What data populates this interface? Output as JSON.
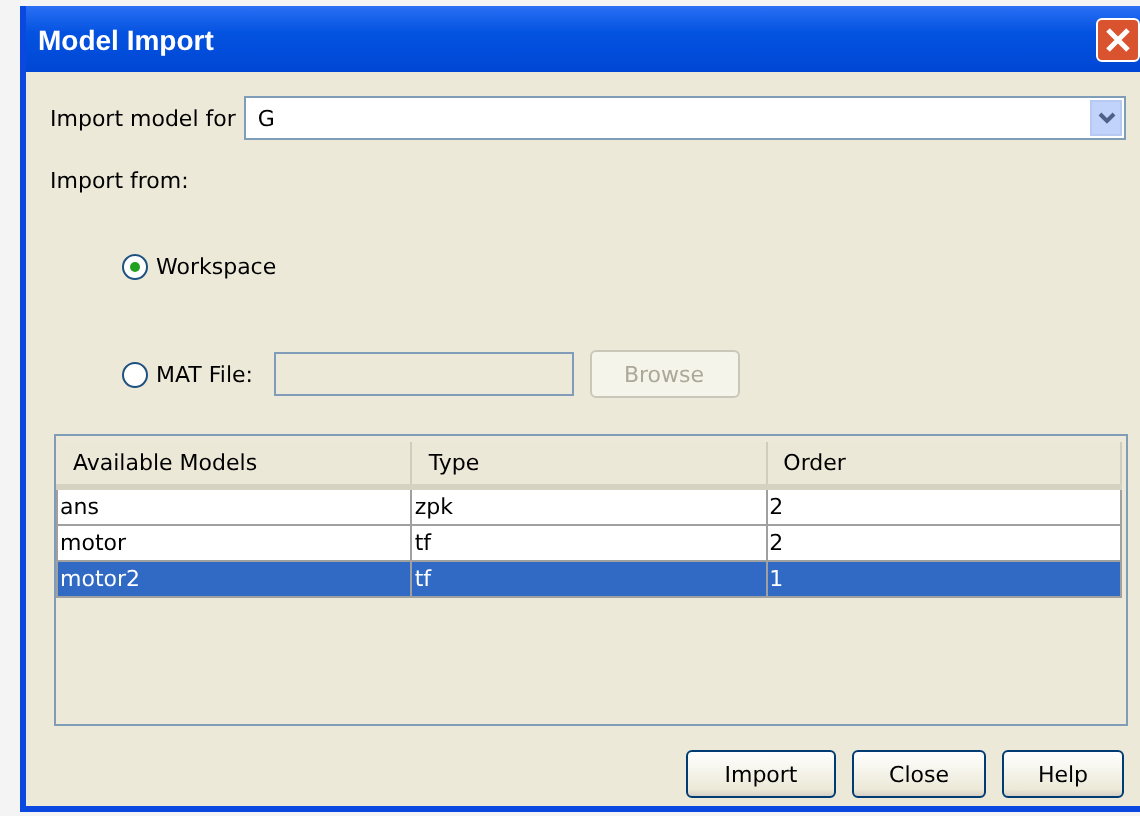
{
  "window": {
    "title": "Model Import"
  },
  "import_model_for": {
    "label": "Import model for",
    "value": "G"
  },
  "import_from": {
    "label": "Import from:",
    "options": [
      {
        "label": "Workspace",
        "selected": true,
        "kind": "plain"
      },
      {
        "label": "MAT File:",
        "selected": false,
        "kind": "file"
      }
    ]
  },
  "mat_file": {
    "disabled": true,
    "browse": {
      "label": "Browse",
      "disabled": true
    }
  },
  "table": {
    "columns": [
      "Available Models",
      "Type",
      "Order"
    ],
    "rows": [
      {
        "cells": [
          "ans",
          "zpk",
          "2"
        ],
        "selected": false
      },
      {
        "cells": [
          "motor",
          "tf",
          "2"
        ],
        "selected": false
      },
      {
        "cells": [
          "motor2",
          "tf",
          "1"
        ],
        "selected": true
      }
    ]
  },
  "buttons": [
    "Import",
    "Close",
    "Help"
  ]
}
